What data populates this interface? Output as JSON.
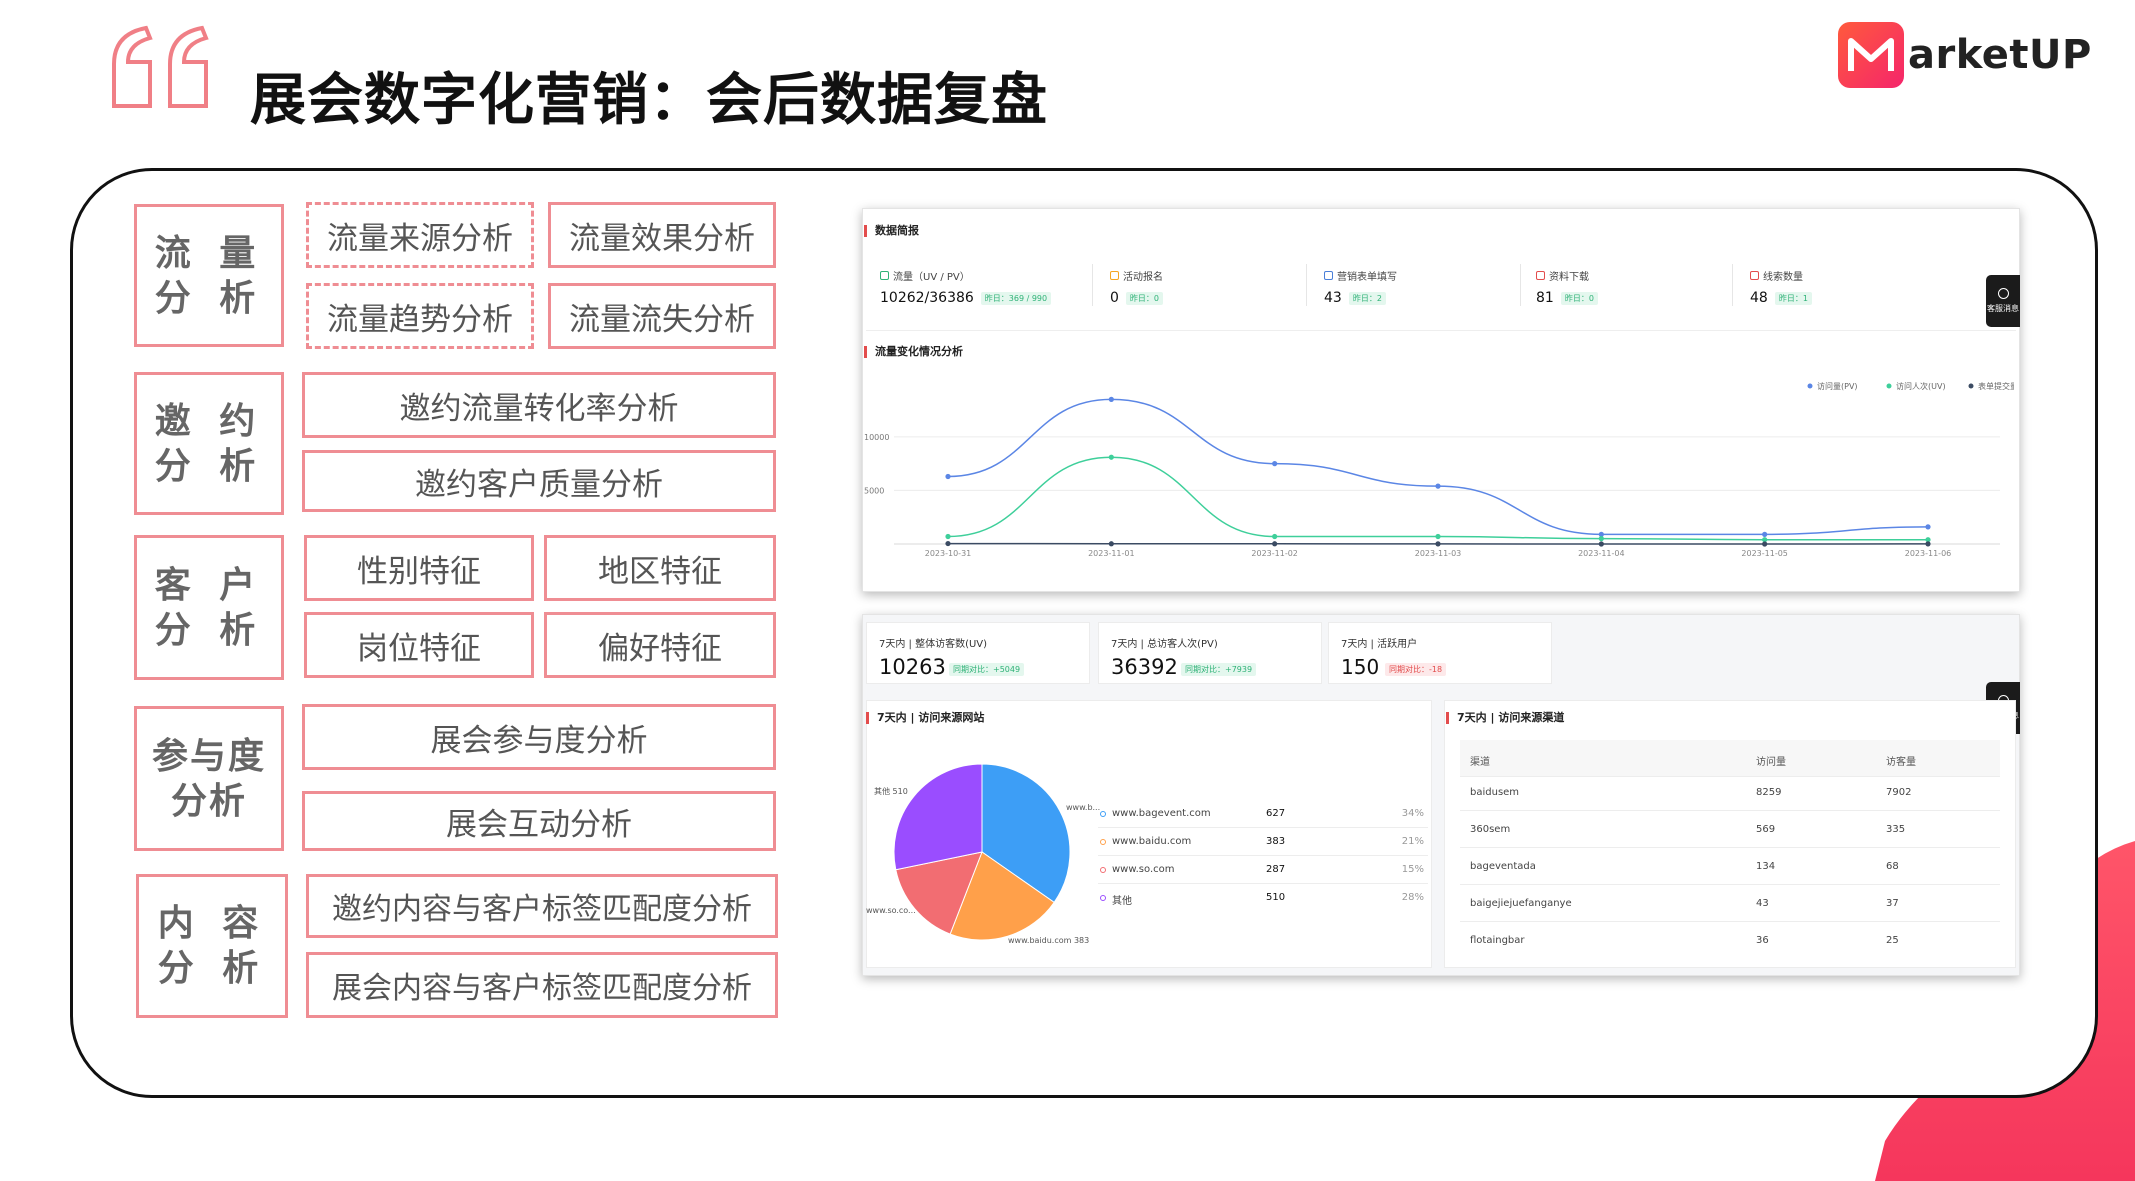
{
  "title": "展会数字化营销：会后数据复盘",
  "brand": {
    "logo_text": "arketUP",
    "accent": "#f5365c"
  },
  "categories": [
    {
      "label": "流 量\n分 析",
      "items": [
        "流量来源分析",
        "流量效果分析",
        "流量趋势分析",
        "流量流失分析"
      ]
    },
    {
      "label": "邀 约\n分 析",
      "items": [
        "邀约流量转化率分析",
        "邀约客户质量分析"
      ]
    },
    {
      "label": "客 户\n分 析",
      "items": [
        "性别特征",
        "地区特征",
        "岗位特征",
        "偏好特征"
      ]
    },
    {
      "label": "参与度\n分析",
      "items": [
        "展会参与度分析",
        "展会互动分析"
      ]
    },
    {
      "label": "内 容\n分 析",
      "items": [
        "邀约内容与客户标签匹配度分析",
        "展会内容与客户标签匹配度分析"
      ]
    }
  ],
  "dashboard": {
    "brief_title": "数据简报",
    "kpis": [
      {
        "label": "流量（UV / PV）",
        "value": "10262/36386",
        "badge": "昨日：369 / 990",
        "color": "#2fb277"
      },
      {
        "label": "活动报名",
        "value": "0",
        "badge": "昨日：0",
        "color": "#f5a623"
      },
      {
        "label": "营销表单填写",
        "value": "43",
        "badge": "昨日：2",
        "color": "#4a7fd8"
      },
      {
        "label": "资料下载",
        "value": "81",
        "badge": "昨日：0",
        "color": "#e34d4d"
      },
      {
        "label": "线索数量",
        "value": "48",
        "badge": "昨日：1",
        "color": "#e34d4d"
      }
    ],
    "float_label": "客服消息",
    "trend_title": "流量变化情况分析",
    "stats": [
      {
        "label": "7天内 | 整体访客数(UV)",
        "value": "10263",
        "badge": "同期对比：+5049"
      },
      {
        "label": "7天内 | 总访客人次(PV)",
        "value": "36392",
        "badge": "同期对比：+7939"
      },
      {
        "label": "7天内 | 活跃用户",
        "value": "150",
        "badge": "同期对比：-18"
      }
    ],
    "sites_title": "7天内 | 访问来源网站",
    "sites": [
      {
        "name": "www.bagevent.com",
        "value": "627",
        "pct": "34%",
        "color": "#3d9ef6"
      },
      {
        "name": "www.baidu.com",
        "value": "383",
        "pct": "21%",
        "color": "#ffa04a"
      },
      {
        "name": "www.so.com",
        "value": "287",
        "pct": "15%",
        "color": "#f26d72"
      },
      {
        "name": "其他",
        "value": "510",
        "pct": "28%",
        "color": "#9a4dff"
      }
    ],
    "pie_labels": {
      "bagevent": "www.b...",
      "baidu": "www.baidu.com  383",
      "so": "www.so.co...",
      "other": "其他  510"
    },
    "channels_title": "7天内 | 访问来源渠道",
    "channel_headers": [
      "渠道",
      "访问量",
      "访客量"
    ],
    "channels": [
      [
        "baidusem",
        "8259",
        "7902"
      ],
      [
        "360sem",
        "569",
        "335"
      ],
      [
        "bageventada",
        "134",
        "68"
      ],
      [
        "baigejiejuefanganye",
        "43",
        "37"
      ],
      [
        "flotaingbar",
        "36",
        "25"
      ]
    ]
  },
  "chart_data": {
    "type": "line",
    "title": "流量变化情况分析",
    "x": [
      "2023-10-31",
      "2023-11-01",
      "2023-11-02",
      "2023-11-03",
      "2023-11-04",
      "2023-11-05",
      "2023-11-06"
    ],
    "y_ticks": [
      "10000",
      "5000"
    ],
    "ylim": [
      0,
      14000
    ],
    "legend_position": "top-right",
    "series": [
      {
        "name": "访问量(PV)",
        "color": "#5b86e5",
        "values": [
          6300,
          13500,
          7500,
          5400,
          900,
          900,
          1600
        ]
      },
      {
        "name": "访问人次(UV)",
        "color": "#3ecf9a",
        "values": [
          700,
          8100,
          700,
          700,
          500,
          400,
          400
        ]
      },
      {
        "name": "表单提交量",
        "color": "#3b4b63",
        "values": [
          40,
          20,
          20,
          10,
          0,
          0,
          10
        ]
      }
    ]
  }
}
